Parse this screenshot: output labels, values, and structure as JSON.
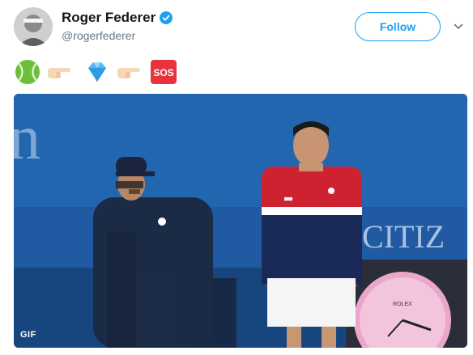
{
  "tweet": {
    "author": {
      "display_name": "Roger Federer",
      "handle": "@rogerfederer",
      "verified": true,
      "avatar_icon": "profile-photo"
    },
    "follow_label": "Follow",
    "menu_icon": "chevron-down-icon",
    "emojis": [
      "tennis-ball-emoji",
      "pointing-right-emoji",
      "gem-emoji",
      "pointing-right-emoji",
      "sos-emoji"
    ],
    "sos_text": "SOS",
    "media": {
      "badge": "GIF",
      "wall_text_left": "n",
      "wall_text_right": "CITIZ",
      "clock_text": "ROLEX"
    }
  },
  "colors": {
    "accent": "#1da1f2",
    "text_primary": "#14171a",
    "text_secondary": "#657786",
    "wall_blue": "#1f5aa3"
  }
}
